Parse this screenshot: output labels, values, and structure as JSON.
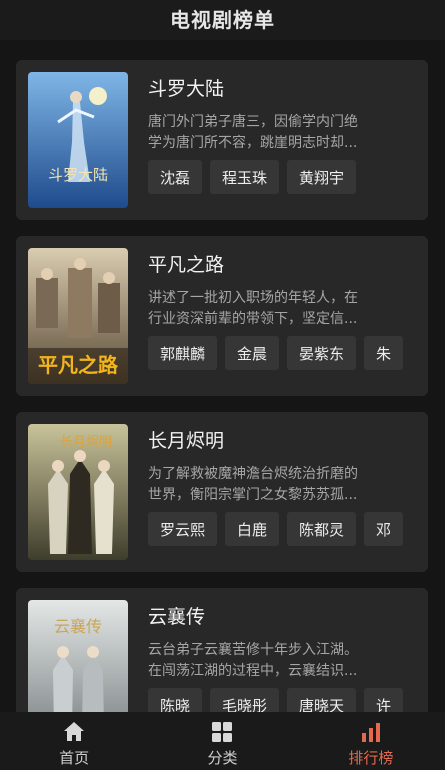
{
  "header": {
    "title": "电视剧榜单"
  },
  "dramas": [
    {
      "title": "斗罗大陆",
      "desc_lines": [
        "唐门外门弟子唐三，因偷学内门绝",
        "学为唐门所不容，跳崖明志时却..."
      ],
      "actors": [
        "沈磊",
        "程玉珠",
        "黄翔宇"
      ],
      "poster_text": "斗罗大陆",
      "poster_colors": [
        "#2b5fa8",
        "#8fc3ea"
      ]
    },
    {
      "title": "平凡之路",
      "desc_lines": [
        "讲述了一批初入职场的年轻人，在",
        "行业资深前辈的带领下，坚定信..."
      ],
      "actors": [
        "郭麒麟",
        "金晨",
        "晏紫东",
        "朱"
      ],
      "poster_text": "平凡之路",
      "poster_colors": [
        "#6b5a43",
        "#d7c7a6"
      ]
    },
    {
      "title": "长月烬明",
      "desc_lines": [
        "为了解救被魔神澹台烬统治折磨的",
        "世界，衡阳宗掌门之女黎苏苏孤..."
      ],
      "actors": [
        "罗云熙",
        "白鹿",
        "陈都灵",
        "邓"
      ],
      "poster_text": "长月烬明",
      "poster_colors": [
        "#4a4a36",
        "#c9c6a2"
      ]
    },
    {
      "title": "云襄传",
      "desc_lines": [
        "云台弟子云襄苦修十年步入江湖。",
        "在闯荡江湖的过程中，云襄结识..."
      ],
      "actors": [
        "陈晓",
        "毛晓彤",
        "唐晓天",
        "许"
      ],
      "poster_text": "云襄传",
      "poster_colors": [
        "#8a8f92",
        "#e3e7e6"
      ]
    }
  ],
  "tabs": [
    {
      "label": "首页",
      "icon": "home-icon"
    },
    {
      "label": "分类",
      "icon": "grid-icon"
    },
    {
      "label": "排行榜",
      "icon": "bar-chart-icon"
    }
  ],
  "colors": {
    "accent": "#e36a4f",
    "card": "#282828",
    "background": "#151515"
  }
}
